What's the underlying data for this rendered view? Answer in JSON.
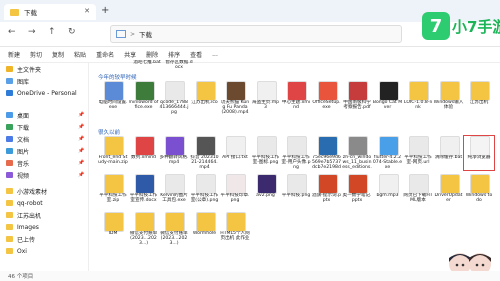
{
  "window": {
    "tab_title": "下载",
    "new_tab": "+"
  },
  "address": {
    "location": "下载",
    "separator": ">"
  },
  "commandbar": [
    "新建",
    "剪切",
    "复制",
    "粘贴",
    "重命名",
    "共享",
    "删除",
    "排序",
    "查看",
    "..."
  ],
  "sidebar": {
    "items": [
      {
        "label": "主文件夹",
        "color": "#f0b429"
      },
      {
        "label": "图库",
        "color": "#5aa0e8"
      },
      {
        "label": "OneDrive - Personal",
        "color": "#2f7bd8"
      },
      {
        "label": "桌面",
        "color": "#4c9be8"
      },
      {
        "label": "下载",
        "color": "#3aa35b"
      },
      {
        "label": "文档",
        "color": "#4c7be8"
      },
      {
        "label": "图片",
        "color": "#3b9ad9"
      },
      {
        "label": "音乐",
        "color": "#e86a4c"
      },
      {
        "label": "视频",
        "color": "#8c5ad8"
      },
      {
        "label": "小游戏素材",
        "color": "#f4c542"
      },
      {
        "label": "qq-robot",
        "color": "#f4c542"
      },
      {
        "label": "江苏出机",
        "color": "#f4c542"
      },
      {
        "label": "Images",
        "color": "#f4c542"
      },
      {
        "label": "已上传",
        "color": "#f4c542"
      },
      {
        "label": "Oxi",
        "color": "#f4c542"
      }
    ]
  },
  "sections": {
    "earlier_month": "今年的较早时候",
    "long_ago": "很久以前"
  },
  "top_files": [
    "酒吧七推.bat",
    "暂存区数据.docx"
  ],
  "row1": [
    {
      "name": "电脑时间设置.exe",
      "color": "#5b8bd6"
    },
    {
      "name": "minioword office.exe",
      "color": "#3d7c3a"
    },
    {
      "name": "qcode_1788413666444.jpg",
      "color": "#e9e9e9"
    },
    {
      "name": "江苏出机.ico",
      "color": "#f4c542"
    },
    {
      "name": "功夫熊猫 Kung Fu Panda (2008).mp4",
      "color": "#6b4a2f"
    },
    {
      "name": "海盗主页.mp3",
      "color": "#f0f0f0"
    },
    {
      "name": "中心主题.xmind",
      "color": "#e04545"
    },
    {
      "name": "OfficeSetup.exe",
      "color": "#e8553c"
    },
    {
      "name": "中国南极科学考察报告.pdf",
      "color": "#c63b3b"
    },
    {
      "name": "Bongo Cat Mver",
      "color": "#222222"
    },
    {
      "name": "LOIC-1.0.8-link",
      "color": "#f4c542"
    },
    {
      "name": "Windows输入体验",
      "color": "#f4c542"
    },
    {
      "name": "江苏出机",
      "color": "#f4c542"
    }
  ],
  "row2": [
    {
      "name": "Front_end Study-main.zip",
      "color": "#f4c542"
    },
    {
      "name": "数列.xmind",
      "color": "#e04545"
    },
    {
      "name": "多种翻转风格.mp4",
      "color": "#7a4fd0"
    },
    {
      "name": "抖音 20231021-214464.mp4",
      "color": "#555"
    },
    {
      "name": "API 接口.txt",
      "color": "#f0f0f0"
    },
    {
      "name": "平平科技工作室-图标.png",
      "color": "#e9e9e9"
    },
    {
      "name": "平平科技工作室-用户头像.png",
      "color": "#e9e9e9"
    },
    {
      "name": "75ec96e9d6569e7b5737dcb7e2198d47.mp4",
      "color": "#2a6cb0"
    },
    {
      "name": "zh-cn_windows_11_business_editions.iso",
      "color": "#8a8a8a"
    },
    {
      "name": "flutter-4.2.2074-Stable.exe",
      "color": "#4aa0e8"
    },
    {
      "name": "平平科技工作室-网页.url",
      "color": "#e9e9e9"
    },
    {
      "name": "清除缓存.bat",
      "color": "#f0f0f0"
    },
    {
      "name": "纯净浏览器",
      "color": "#f4f4f4"
    }
  ],
  "row3": [
    {
      "name": "平平科技工作室.zip",
      "color": "#f4c542"
    },
    {
      "name": "平平科技工作室宣传.docx",
      "color": "#2f5aa8"
    },
    {
      "name": "Kelvin的图片工具包.exe",
      "color": "#e9e9e9"
    },
    {
      "name": "平平科技工作室(公章).png",
      "color": "#e9e9e9"
    },
    {
      "name": "平平科技印章.png",
      "color": "#f0e8e8"
    },
    {
      "name": "av2.png",
      "color": "#3c2a6e"
    },
    {
      "name": "平平科技.png",
      "color": "#e9e9e9"
    },
    {
      "name": "酒旗-提示词.pptx",
      "color": "#d24726"
    },
    {
      "name": "奥—数学笔记.pptx",
      "color": "#d24726"
    },
    {
      "name": "bgm.mp3",
      "color": "#f0f0f0"
    },
    {
      "name": "网页已下载HTML版本",
      "color": "#e9e9e9"
    },
    {
      "name": "DriverUpdater",
      "color": "#f4c542"
    },
    {
      "name": "Windows to do",
      "color": "#f4c542"
    }
  ],
  "row4": [
    {
      "name": "IDM",
      "color": "#f4c542"
    },
    {
      "name": "微信支付账单(2023...2023...)",
      "color": "#f4c542"
    },
    {
      "name": "微信支付账单(2023...2023...)",
      "color": "#f4c542"
    },
    {
      "name": "Wormhole",
      "color": "#f4c542"
    },
    {
      "name": "HTML5个人网页出机 此作业",
      "color": "#f4c542"
    }
  ],
  "status": {
    "count": "46 个项目"
  },
  "watermark": {
    "glyph": "7",
    "text": "小7手游"
  }
}
